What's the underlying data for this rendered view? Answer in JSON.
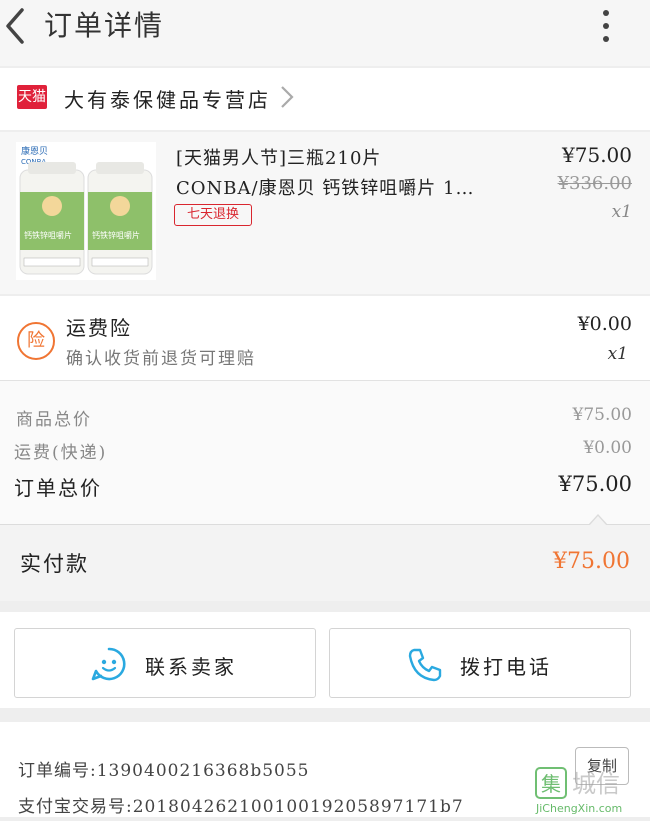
{
  "header": {
    "title": "订单详情",
    "back_icon": "chevron-left-icon",
    "more_icon": "more-vertical-icon"
  },
  "store": {
    "badge": "天猫",
    "name": "大有泰保健品专营店",
    "brand_color": "#e0213a"
  },
  "product": {
    "title_line1": "[天猫男人节]三瓶210片",
    "title_line2": "CONBA/康恩贝 钙铁锌咀嚼片 1…",
    "return_badge": "七天退换",
    "price": "¥75.00",
    "original_price": "¥336.00",
    "quantity": "x1",
    "image_brand": "康恩贝",
    "image_brand_en": "CONBA",
    "image_label": "钙铁锌咀嚼片"
  },
  "insurance": {
    "icon_text": "险",
    "title": "运费险",
    "subtitle": "确认收货前退货可理赔",
    "price": "¥0.00",
    "quantity": "x1"
  },
  "totals": {
    "goods_label": "商品总价",
    "goods_value": "¥75.00",
    "shipping_label": "运费(快递)",
    "shipping_value": "¥0.00",
    "order_label": "订单总价",
    "order_value": "¥75.00"
  },
  "payment": {
    "label": "实付款",
    "value": "¥75.00",
    "accent_color": "#f07533"
  },
  "actions": {
    "contact_label": "联系卖家",
    "call_label": "拨打电话"
  },
  "info": {
    "order_no_label": "订单编号:",
    "order_no": "1390400216368b5055",
    "alipay_label": "支付宝交易号:",
    "alipay_no": "20180426210010019205897171b7",
    "copy_label": "复制"
  },
  "watermark": {
    "char": "集",
    "brand": "城信",
    "site": "JiChengXin.com"
  }
}
